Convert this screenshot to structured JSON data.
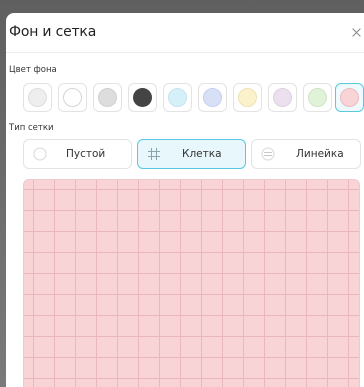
{
  "dialog": {
    "title": "Фон и сетка",
    "close_icon": "close-icon"
  },
  "background": {
    "label": "Цвет фона",
    "swatches": [
      {
        "color": "#eeeeee",
        "selected": false
      },
      {
        "color": "#ffffff",
        "selected": false
      },
      {
        "color": "#dddddd",
        "selected": false
      },
      {
        "color": "#444444",
        "selected": false
      },
      {
        "color": "#d6f0fa",
        "selected": false
      },
      {
        "color": "#d8e0f8",
        "selected": false
      },
      {
        "color": "#fbf2cc",
        "selected": false
      },
      {
        "color": "#ece0ef",
        "selected": false
      },
      {
        "color": "#e0f2d8",
        "selected": false
      },
      {
        "color": "#f8d4d6",
        "selected": true
      }
    ]
  },
  "grid": {
    "label": "Тип сетки",
    "options": [
      {
        "label": "Пустой",
        "icon": "empty-circle-icon",
        "selected": false
      },
      {
        "label": "Клетка",
        "icon": "hash-grid-icon",
        "selected": true
      },
      {
        "label": "Линейка",
        "icon": "ruled-lines-icon",
        "selected": false
      }
    ]
  },
  "preview": {
    "background_color": "#f8d4d6",
    "grid_color": "#eab7bb"
  }
}
